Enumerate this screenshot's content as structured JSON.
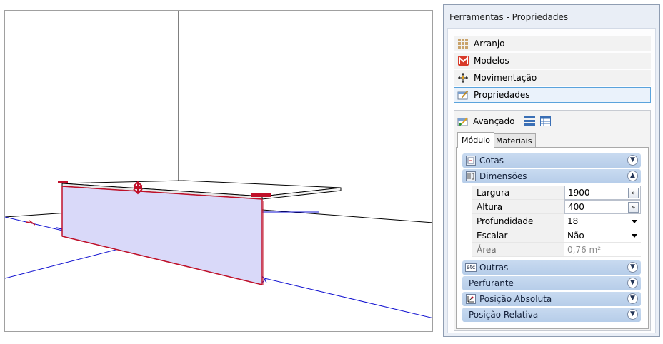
{
  "panel": {
    "title": "Ferramentas - Propriedades",
    "nav": [
      {
        "label": "Arranjo",
        "icon": "grid-icon"
      },
      {
        "label": "Modelos",
        "icon": "m-logo-icon"
      },
      {
        "label": "Movimentação",
        "icon": "move-arrows-icon"
      },
      {
        "label": "Propriedades",
        "icon": "properties-icon",
        "selected": true
      }
    ],
    "advanced": {
      "label": "Avançado",
      "tabs": [
        "Módulo",
        "Materiais"
      ]
    },
    "sections": {
      "cotas": "Cotas",
      "dimensoes": "Dimensões",
      "outras": "Outras",
      "outras_badge": "etc",
      "perfurante": "Perfurante",
      "posicao_absoluta": "Posição Absoluta",
      "posicao_relativa": "Posição Relativa"
    },
    "properties": [
      {
        "label": "Largura",
        "value": "1900",
        "control": "button",
        "button_label": "»"
      },
      {
        "label": "Altura",
        "value": "400",
        "control": "button",
        "button_label": "»"
      },
      {
        "label": "Profundidade",
        "value": "18",
        "control": "dropdown"
      },
      {
        "label": "Escalar",
        "value": "Não",
        "control": "dropdown"
      },
      {
        "label": "Área",
        "value": "0,76 m²",
        "control": "readonly"
      }
    ]
  },
  "colors": {
    "panel_bg": "#e9eef6",
    "section_bg": "#c8daf0",
    "selection_border": "#5aa3dc",
    "panel_fill": "#d9d9f9",
    "edge_red": "#c0102a",
    "axis_blue": "#1010d0"
  }
}
